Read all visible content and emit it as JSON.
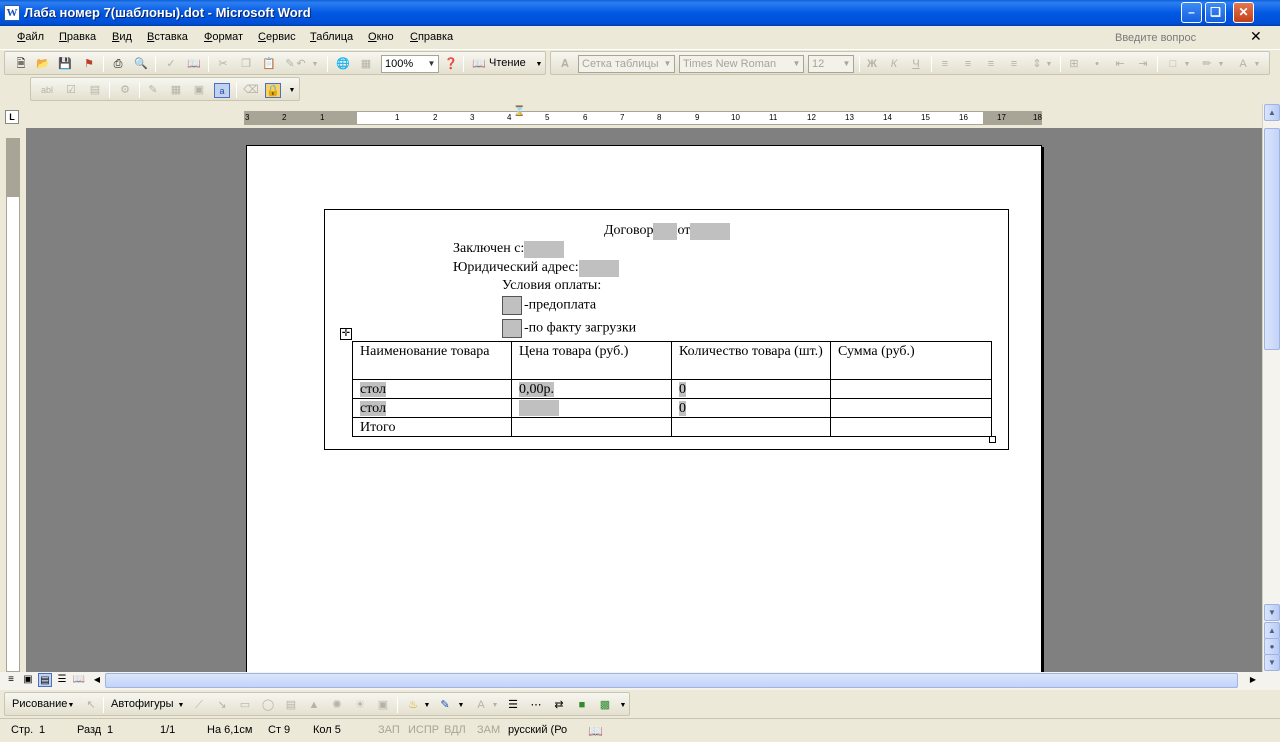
{
  "window": {
    "title": "Лаба номер 7(шаблоны).dot - Microsoft Word",
    "app_icon": "W"
  },
  "menu": [
    "Файл",
    "Правка",
    "Вид",
    "Вставка",
    "Формат",
    "Сервис",
    "Таблица",
    "Окно",
    "Справка"
  ],
  "ask_placeholder": "Введите вопрос",
  "toolbar": {
    "zoom": "100%",
    "read_label": "Чтение",
    "style": "Сетка таблицы",
    "font": "Times New Roman",
    "size": "12"
  },
  "ruler": {
    "labels": [
      "3",
      "2",
      "1",
      "",
      "1",
      "2",
      "3",
      "4",
      "5",
      "6",
      "7",
      "8",
      "9",
      "10",
      "11",
      "12",
      "13",
      "14",
      "15",
      "16",
      "17",
      "18"
    ]
  },
  "document": {
    "line1_a": "Договор",
    "line1_b": "от",
    "line2": "Заключен с:",
    "line3": "Юридический адрес:",
    "line4": "Условия оплаты:",
    "opt1": "-предоплата",
    "opt2": "-по факту загрузки",
    "table": {
      "headers": [
        "Наименование товара",
        "Цена товара (руб.)",
        "Количество товара (шт.)",
        "Сумма (руб.)"
      ],
      "rows": [
        [
          "стол",
          "0,00р.",
          "0",
          ""
        ],
        [
          "стол",
          "",
          "0",
          ""
        ],
        [
          "Итого",
          "",
          "",
          ""
        ]
      ]
    }
  },
  "drawing": {
    "draw_label": "Рисование",
    "autoshapes_label": "Автофигуры"
  },
  "status": {
    "page": "Стр.",
    "page_no": "1",
    "section": "Разд",
    "section_no": "1",
    "pages": "1/1",
    "at": "На 6,1см",
    "line": "Ст 9",
    "col": "Кол 5",
    "rec": "ЗАП",
    "trk": "ИСПР",
    "ext": "ВДЛ",
    "ovr": "ЗАМ",
    "lang": "русский (Ро"
  }
}
